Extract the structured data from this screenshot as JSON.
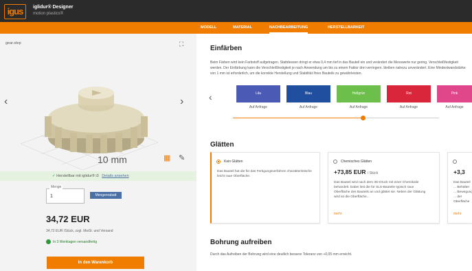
{
  "header": {
    "logo": "igus",
    "title": "iglidur® Designer",
    "subtitle": "motion plastics®"
  },
  "nav": {
    "tabs": [
      {
        "label": "MODELL"
      },
      {
        "label": "MATERIAL"
      },
      {
        "label": "NACHBEARBEITUNG",
        "active": true
      },
      {
        "label": "HERSTELLBARKEIT"
      }
    ]
  },
  "viewer": {
    "filename": "gear.step",
    "dimension": "10 mm"
  },
  "order": {
    "manufacturable_text": "Herstellbar mit iglidur® i3",
    "details_link": "Details ansehen",
    "quantity_label": "Menge",
    "quantity_value": "1",
    "bulk_discount": "Mengenrabatt",
    "price": "34,72 EUR",
    "price_note": "34,72 EUR /Stück, zzgl. MwSt. und Versand",
    "shipping": "In 3 Werktagen versandfertig",
    "cart_button": "In den Warenkorb"
  },
  "einfaerben": {
    "title": "Einfärben",
    "text": "Beim Färben wird kein Farbstoff aufgetragen. Stattdessen dringt er etwa 0,4 mm tief in das Bauteil ein und verändert die Messwerte nur gering. Verschleißfestigkeit werden. Der Einfärbung kann die Verschleißfestigkeit je nach Anwendung um bis zu einem Faktor drei verringern. bleiben nahezu unverändert. Eine Mindestwandstärke von 1 mm ist erforderlich, um die korrekte Herstellung und Stabilität Ihres Bauteils zu gewährleisten.",
    "colors": [
      {
        "label": "Lila",
        "sub": "Auf Anfrage",
        "color": "#4b5bb5"
      },
      {
        "label": "Blau",
        "sub": "Auf Anfrage",
        "color": "#1f4f9e"
      },
      {
        "label": "Hellgrün",
        "sub": "Auf Anfrage",
        "color": "#6cbf4a"
      },
      {
        "label": "Rot",
        "sub": "Auf Anfrage",
        "color": "#d9263a"
      },
      {
        "label": "Pink",
        "sub": "Auf Anfrage",
        "color": "#e0468a"
      }
    ],
    "slider_fraction": 0.63
  },
  "glaetten": {
    "title": "Glätten",
    "options": [
      {
        "title": "Kein Glätten",
        "price": "",
        "price_unit": "",
        "text": "Das Bauteil hat die für das Fertigungsverfahren charakteristische leicht raue Oberfläche.",
        "link": "",
        "selected": true
      },
      {
        "title": "Chemisches Glätten",
        "price": "+73,85 EUR",
        "price_unit": "/ Stück",
        "text": "Das Bauteil wird nach dem 3D-Druck mit einer Chemikalie behandelt. Dabei löst die für SLS-Bauteile typisch raue Oberfläche des Bauteils an und glättet sie. Neben der Glättung wird so die Oberfläche...",
        "link": "mehr",
        "selected": false
      },
      {
        "title": "",
        "price": "+3,3",
        "price_unit": "",
        "text": "Das Bauteil ... Behälter ... Bewegung ... der Oberfläche",
        "link": "mehr",
        "selected": false
      }
    ]
  },
  "bohrung": {
    "title": "Bohrung aufreiben",
    "text": "Durch das Aufreiben der Bohrung wird eine deutlich bessere Toleranz von +0,05 mm erreicht."
  }
}
